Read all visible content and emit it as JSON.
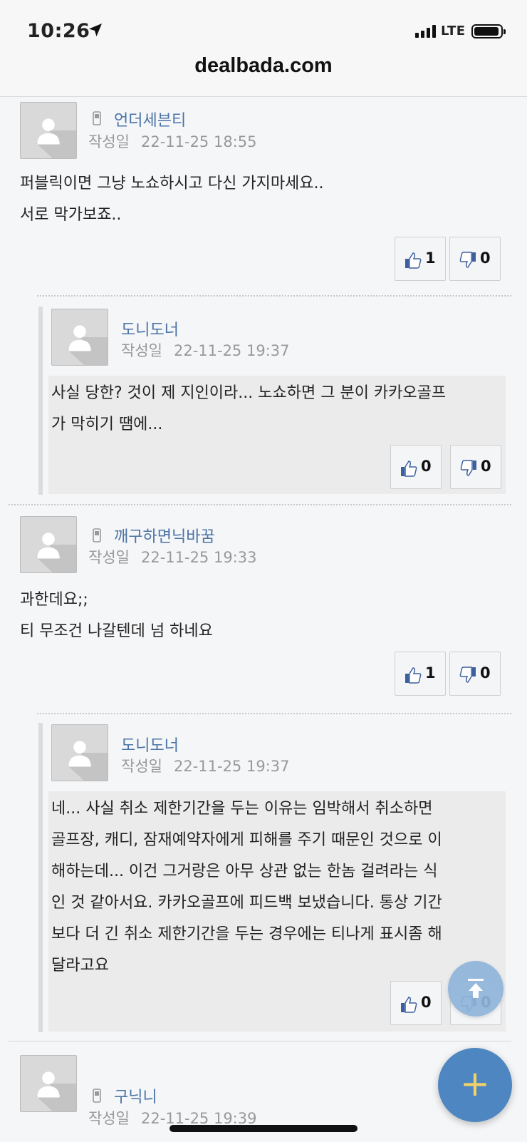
{
  "status_bar": {
    "time": "10:26",
    "network": "LTE"
  },
  "browser": {
    "url": "dealbada.com"
  },
  "icons": {
    "avatar": "default-user-avatar-icon",
    "device": "mobile-phone-icon",
    "like": "thumbs-up-icon",
    "dislike": "thumbs-down-icon",
    "scroll_top": "scroll-to-top-icon",
    "add": "plus-icon"
  },
  "comments": [
    {
      "author": "언더세븐티",
      "date_label": "작성일",
      "date": "22-11-25 18:55",
      "lines": [
        "퍼블릭이면 그냥 노쇼하시고 다신 가지마세요..",
        "서로 막가보죠.."
      ],
      "likes": "1",
      "dislikes": "0",
      "reply": {
        "author": "도니도너",
        "date_label": "작성일",
        "date": "22-11-25 19:37",
        "lines": [
          "사실 당한? 것이 제 지인이라... 노쇼하면 그 분이 카카오골프",
          "가 막히기 땜에..."
        ],
        "likes": "0",
        "dislikes": "0"
      }
    },
    {
      "author": "깨구하면닉바꿈",
      "date_label": "작성일",
      "date": "22-11-25 19:33",
      "lines": [
        "과한데요;;",
        "티 무조건 나갈텐데 넘 하네요"
      ],
      "likes": "1",
      "dislikes": "0",
      "reply": {
        "author": "도니도너",
        "date_label": "작성일",
        "date": "22-11-25 19:37",
        "lines": [
          "네... 사실 취소 제한기간을 두는 이유는 임박해서 취소하면",
          "골프장, 캐디, 잠재예약자에게 피해를 주기 때문인 것으로 이",
          "해하는데... 이건 그거랑은 아무 상관 없는 한놈 걸려라는 식",
          "인 것 같아서요. 카카오골프에 피드백 보냈습니다. 통상 기간",
          "보다 더 긴 취소 제한기간을 두는 경우에는 티나게 표시좀 해",
          "달라고요"
        ],
        "likes": "0",
        "dislikes": "0"
      }
    },
    {
      "author": "구닉니",
      "date_label": "작성일",
      "date": "22-11-25 19:39"
    }
  ],
  "colors": {
    "author": "#4a73a6",
    "fab": "#4d86c0",
    "fab_top": "#8fb4da",
    "plus": "#f2d16a"
  }
}
